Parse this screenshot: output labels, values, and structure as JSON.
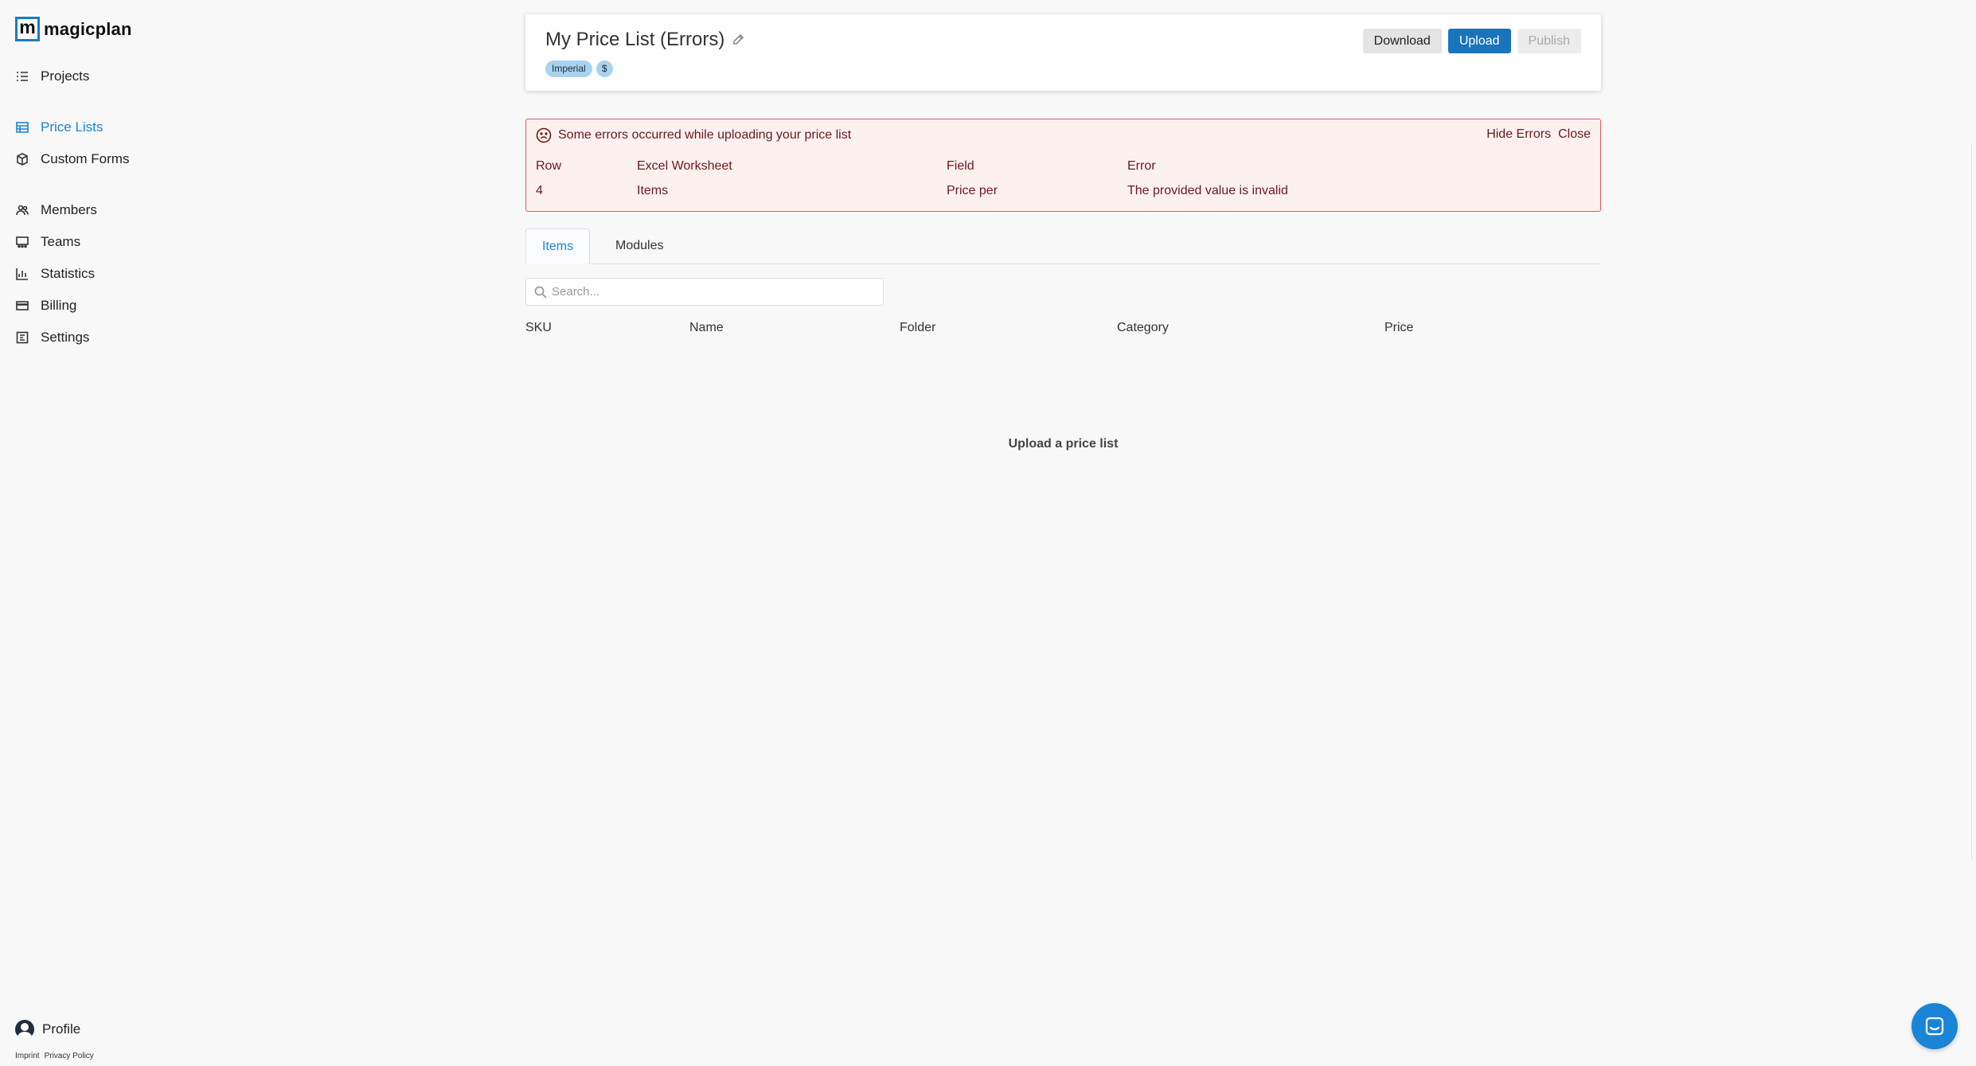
{
  "brand": {
    "mark": "m",
    "name": "magicplan"
  },
  "sidebar": {
    "items": [
      {
        "label": "Projects",
        "icon": "list-icon"
      },
      {
        "label": "Price Lists",
        "icon": "table-icon",
        "active": true
      },
      {
        "label": "Custom Forms",
        "icon": "cube-icon"
      },
      {
        "label": "Members",
        "icon": "users-icon"
      },
      {
        "label": "Teams",
        "icon": "team-icon"
      },
      {
        "label": "Statistics",
        "icon": "bar-chart-icon"
      },
      {
        "label": "Billing",
        "icon": "card-icon"
      },
      {
        "label": "Settings",
        "icon": "settings-icon"
      }
    ],
    "profile": "Profile",
    "footer": {
      "imprint": "Imprint",
      "privacy": "Privacy Policy"
    }
  },
  "header": {
    "title": "My Price List (Errors)",
    "badges": [
      "Imperial",
      "$"
    ],
    "buttons": {
      "download": "Download",
      "upload": "Upload",
      "publish": "Publish"
    }
  },
  "errors": {
    "message": "Some errors occurred while uploading your price list",
    "hide": "Hide Errors",
    "close": "Close",
    "columns": [
      "Row",
      "Excel Worksheet",
      "Field",
      "Error"
    ],
    "rows": [
      [
        "4",
        "Items",
        "Price per",
        "The provided value is invalid"
      ]
    ]
  },
  "tabs": [
    "Items",
    "Modules"
  ],
  "search": {
    "placeholder": "Search...",
    "value": ""
  },
  "table": {
    "columns": [
      "SKU",
      "Name",
      "Folder",
      "Category",
      "Price"
    ],
    "empty": "Upload a price list"
  },
  "colors": {
    "accent": "#1a85d6",
    "primary_button": "#1a74bb",
    "error_border": "#e55a5a",
    "error_bg": "#fdf1f0"
  }
}
